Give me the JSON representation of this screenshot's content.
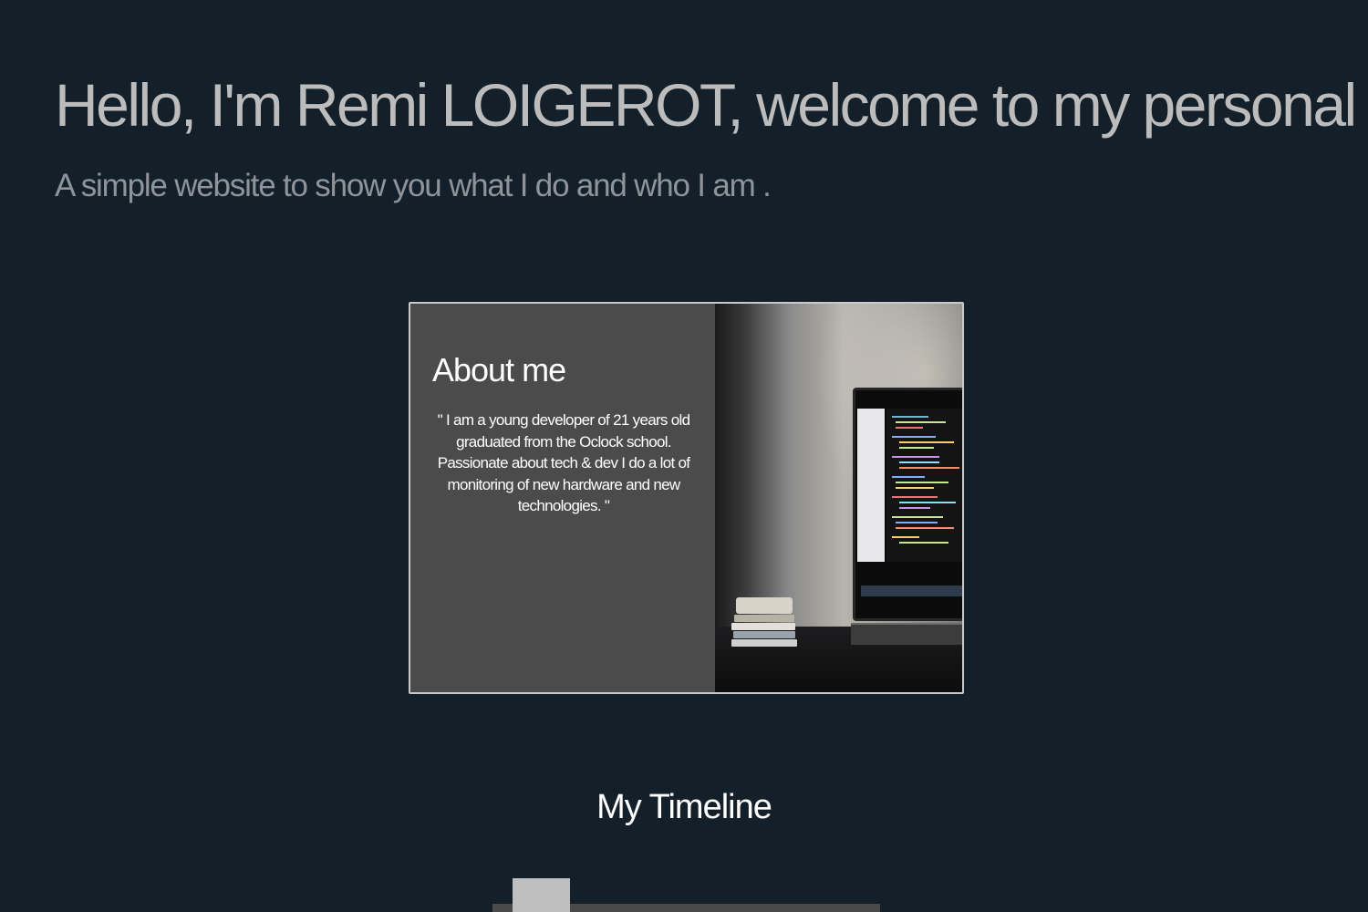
{
  "hero": {
    "title": "Hello, I'm Remi LOIGEROT, welcome to my personal w",
    "subtitle": "A simple website to show you what I do and who I am ."
  },
  "about": {
    "title": "About me",
    "quote": "\" I am a young developer of 21 years old graduated from the Oclock school. Passionate about tech & dev I do a lot of monitoring of new hardware and new technologies. \"",
    "image_icon": "laptop-photo"
  },
  "timeline": {
    "title": "My Timeline"
  },
  "colors": {
    "background": "#13202a",
    "card": "#4b4b4b",
    "title_text": "#bcbcbc",
    "subtitle_text": "#8e9499"
  }
}
